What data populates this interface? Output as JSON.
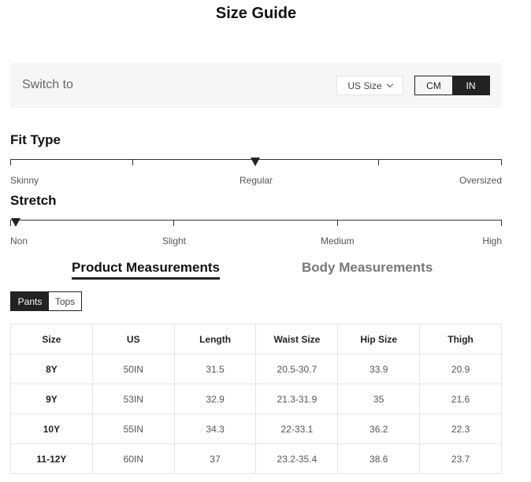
{
  "title": "Size Guide",
  "switch": {
    "label": "Switch to",
    "size_system": "US Size",
    "units": [
      "CM",
      "IN"
    ],
    "active_unit": "IN"
  },
  "fit_type": {
    "heading": "Fit Type",
    "labels": [
      "Skinny",
      "Regular",
      "Oversized"
    ],
    "selected": "Regular"
  },
  "stretch": {
    "heading": "Stretch",
    "labels": [
      "Non",
      "Slight",
      "Medium",
      "High"
    ],
    "selected": "Non"
  },
  "tabs": {
    "product": "Product Measurements",
    "body": "Body Measurements"
  },
  "subtabs": [
    "Pants",
    "Tops"
  ],
  "table": {
    "headers": [
      "Size",
      "US",
      "Length",
      "Waist Size",
      "Hip Size",
      "Thigh"
    ],
    "rows": [
      [
        "8Y",
        "50IN",
        "31.5",
        "20.5-30.7",
        "33.9",
        "20.9"
      ],
      [
        "9Y",
        "53IN",
        "32.9",
        "21.3-31.9",
        "35",
        "21.6"
      ],
      [
        "10Y",
        "55IN",
        "34.3",
        "22-33.1",
        "36.2",
        "22.3"
      ],
      [
        "11-12Y",
        "60IN",
        "37",
        "23.2-35.4",
        "38.6",
        "23.7"
      ]
    ]
  }
}
